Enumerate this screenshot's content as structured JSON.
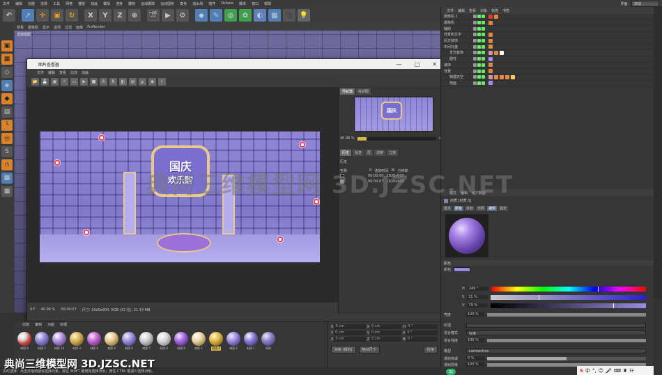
{
  "menubar": {
    "items": [
      "文件",
      "编辑",
      "创建",
      "选择",
      "工具",
      "网格",
      "捕捉",
      "动画",
      "模拟",
      "渲染",
      "雕刻",
      "运动跟踪",
      "运动图形",
      "角色",
      "流水线",
      "插件",
      "Octane",
      "脚本",
      "窗口",
      "帮助"
    ],
    "layout_label": "界面:",
    "layout_value": "启动"
  },
  "toolbar": {
    "icons": [
      "undo-icon",
      "select-icon",
      "move-icon",
      "scale-icon",
      "rotate-icon",
      "x-axis-icon",
      "y-axis-icon",
      "z-axis-icon",
      "coord-icon",
      "render-view-icon",
      "render-picture-icon",
      "render-settings-icon",
      "cube-icon",
      "pen-icon",
      "subdivision-icon",
      "cloner-icon",
      "bend-icon",
      "floor-icon",
      "camera-icon",
      "light-icon"
    ],
    "x_label": "X",
    "y_label": "Y",
    "z_label": "Z"
  },
  "viewport": {
    "menu": [
      "查看",
      "摄像机",
      "显示",
      "选项",
      "过滤",
      "面板",
      "ProRender"
    ],
    "label": "透视视图"
  },
  "picture_viewer": {
    "title": "图片查看器",
    "menu": [
      "文件",
      "编辑",
      "查看",
      "比较",
      "动画"
    ],
    "zoom": "40.96 %",
    "time": "00:00:07",
    "info": "尺寸: 1920x900, RGB (32 位), 21.14 MB",
    "frame": "0 F",
    "nav_tabs": [
      "导航器",
      "柱状图"
    ],
    "nav_zoom": "40.96 %",
    "nav_zoom_fraction": 0.12,
    "hist_tabs": [
      "历史",
      "信息",
      "层",
      "滤镜",
      "立体"
    ],
    "hist_header": "历史",
    "hist_columns": [
      "名称",
      "R",
      "渲染时间",
      "W",
      "分辨率"
    ],
    "hist_rows": [
      {
        "name": "",
        "r": "",
        "time": "00:00:00",
        "res": "1920x900"
      },
      {
        "name": "",
        "r": "",
        "time": "00:00:07",
        "res": "1920x900"
      }
    ],
    "render_sign_l1": "国庆",
    "render_sign_l2": "欢乐购"
  },
  "material_panel": {
    "menu": [
      "创建",
      "编辑",
      "功能",
      "纹理"
    ],
    "materials": [
      "材质.6",
      "材质.5",
      "材质.10",
      "材质.3",
      "材质.6",
      "材质.4",
      "材质.6",
      "材质.7",
      "材质.8",
      "材质.9",
      "材质.1",
      "材质.3",
      "材质.2",
      "材质.1",
      "材质"
    ],
    "selected_index": 11
  },
  "coordinates": {
    "fields": [
      {
        "axis": "X",
        "value": "0 cm"
      },
      {
        "axis": "X",
        "value": "0 cm"
      },
      {
        "axis": "H",
        "value": "0 °"
      },
      {
        "axis": "Y",
        "value": "0 cm"
      },
      {
        "axis": "Y",
        "value": "0 cm"
      },
      {
        "axis": "P",
        "value": "0 °"
      },
      {
        "axis": "Z",
        "value": "0 cm"
      },
      {
        "axis": "Z",
        "value": "0 cm"
      },
      {
        "axis": "B",
        "value": "0 °"
      }
    ],
    "mode": "对象 (相对)",
    "size_mode": "绝对尺寸",
    "apply": "应用"
  },
  "statusbar": "实时选择：点击并拖动鼠标选择元素。按住 SHIFT 键增加选择对象；按住 CTRL 键减少选择对象。",
  "object_manager": {
    "menu": [
      "文件",
      "编辑",
      "查看",
      "对象",
      "标签",
      "书签"
    ],
    "rows": [
      {
        "name": "摄像机.1",
        "indent": 0
      },
      {
        "name": "摄像机",
        "indent": 0
      },
      {
        "name": "辅助",
        "indent": 0
      },
      {
        "name": "背景和文字",
        "indent": 0
      },
      {
        "name": "后方装饰",
        "indent": 0
      },
      {
        "name": "中间托盘",
        "indent": 0
      },
      {
        "name": "发光装饰",
        "indent": 1
      },
      {
        "name": "圆柱",
        "indent": 1
      },
      {
        "name": "装饰",
        "indent": 0
      },
      {
        "name": "背景",
        "indent": 0
      },
      {
        "name": "物理天空",
        "indent": 1
      },
      {
        "name": "地面",
        "indent": 1
      }
    ]
  },
  "attribute_manager": {
    "menu": [
      "模式",
      "编辑",
      "用户数据"
    ],
    "title": "材质 [材质.3]",
    "tabs": [
      "基本",
      "颜色",
      "反射",
      "光照",
      "编辑",
      "指定"
    ],
    "active_tab": "颜色",
    "section": "颜色",
    "color_label": "颜色",
    "color_hex": "#9b8be0",
    "h_value": "249 °",
    "s_value": "31 %",
    "v_value": "79 %",
    "h_fraction": 0.69,
    "s_fraction": 0.31,
    "v_fraction": 0.79,
    "brightness_label": "亮度",
    "brightness_value": "100 %",
    "texture_label": "纹理",
    "mix_mode_label": "混合模式",
    "mix_mode_value": "标准",
    "mix_strength_label": "混合强度",
    "mix_strength_value": "100 %",
    "model_label": "模型",
    "model_value": "Lambertian",
    "diffuse_falloff_label": "漫射衰减",
    "diffuse_falloff_value": "0 %",
    "diffuse_level_label": "漫射层级",
    "diffuse_level_value": "100 %"
  },
  "watermark": "典尚三维模型网 3D.JZSC.NET",
  "watermark_bottom": "典尚三维模型网 3D.JZSC.NET",
  "ime": {
    "label": "中"
  },
  "time_badge": "32"
}
